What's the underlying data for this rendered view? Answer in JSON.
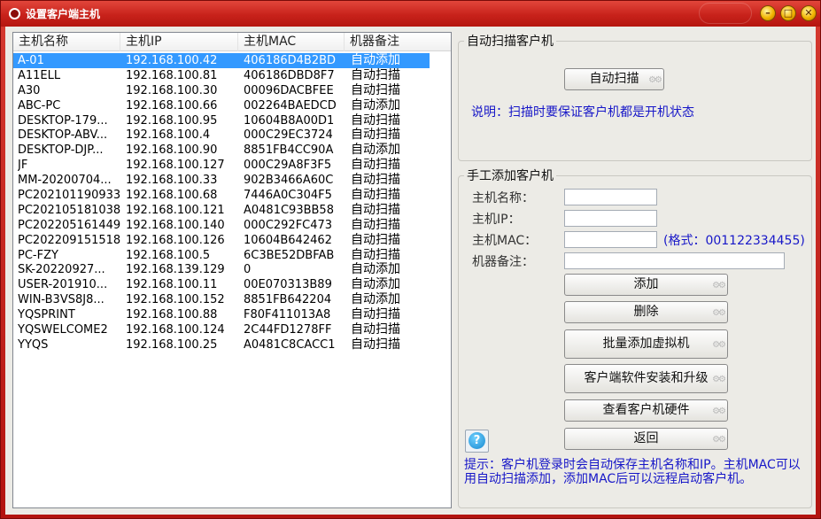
{
  "window": {
    "title": "设置客户端主机",
    "controls": {
      "minimize": "–",
      "maximize": "□",
      "close": "✕"
    }
  },
  "list": {
    "columns": [
      "主机名称",
      "主机IP",
      "主机MAC",
      "机器备注"
    ],
    "rows": [
      [
        "A-01",
        "192.168.100.42",
        "406186D4B2BD",
        "自动添加"
      ],
      [
        "A11ELL",
        "192.168.100.81",
        "406186DBD8F7",
        "自动扫描"
      ],
      [
        "A30",
        "192.168.100.30",
        "00096DACBFEE",
        "自动扫描"
      ],
      [
        "ABC-PC",
        "192.168.100.66",
        "002264BAEDCD",
        "自动添加"
      ],
      [
        "DESKTOP-179...",
        "192.168.100.95",
        "10604B8A00D1",
        "自动扫描"
      ],
      [
        "DESKTOP-ABV...",
        "192.168.100.4",
        "000C29EC3724",
        "自动扫描"
      ],
      [
        "DESKTOP-DJP...",
        "192.168.100.90",
        "8851FB4CC90A",
        "自动添加"
      ],
      [
        "JF",
        "192.168.100.127",
        "000C29A8F3F5",
        "自动扫描"
      ],
      [
        "MM-20200704...",
        "192.168.100.33",
        "902B3466A60C",
        "自动扫描"
      ],
      [
        "PC202101190933",
        "192.168.100.68",
        "7446A0C304F5",
        "自动扫描"
      ],
      [
        "PC202105181038",
        "192.168.100.121",
        "A0481C93BB58",
        "自动扫描"
      ],
      [
        "PC202205161449",
        "192.168.100.140",
        "000C292FC473",
        "自动扫描"
      ],
      [
        "PC202209151518",
        "192.168.100.126",
        "10604B642462",
        "自动扫描"
      ],
      [
        "PC-FZY",
        "192.168.100.5",
        "6C3BE52DBFAB",
        "自动扫描"
      ],
      [
        "SK-20220927...",
        "192.168.139.129",
        "0",
        "自动添加"
      ],
      [
        "USER-201910...",
        "192.168.100.11",
        "00E070313B89",
        "自动添加"
      ],
      [
        "WIN-B3VS8J8...",
        "192.168.100.152",
        "8851FB642204",
        "自动添加"
      ],
      [
        "YQSPRINT",
        "192.168.100.88",
        "F80F411013A8",
        "自动扫描"
      ],
      [
        "YQSWELCOME2",
        "192.168.100.124",
        "2C44FD1278FF",
        "自动扫描"
      ],
      [
        "YYQS",
        "192.168.100.25",
        "A0481C8CACC1",
        "自动扫描"
      ]
    ]
  },
  "auto": {
    "group_title": "自动扫描客户机",
    "scan_button": "自动扫描",
    "note": "说明：扫描时要保证客户机都是开机状态"
  },
  "manual": {
    "group_title": "手工添加客户机",
    "name_label": "主机名称：",
    "ip_label": "主机IP：",
    "mac_label": "主机MAC：",
    "mac_hint": "(格式：001122334455)",
    "remark_label": "机器备注：",
    "name_value": "",
    "ip_value": "",
    "mac_value": "",
    "remark_value": ""
  },
  "buttons": {
    "add": "添加",
    "delete": "删除",
    "batch_add": "批量添加虚拟机",
    "install_upgrade": "客户端软件安装和升级",
    "view_hardware": "查看客户机硬件",
    "back": "返回",
    "help": "?"
  },
  "tip": "提示：客户机登录时会自动保存主机名称和IP。主机MAC可以用自动扫描添加，添加MAC后可以远程启动客户机。",
  "colors": {
    "titlebar": "#c8221b",
    "selection": "#3399ff",
    "link_text": "#1717c8",
    "client_bg": "#ecebe6"
  }
}
